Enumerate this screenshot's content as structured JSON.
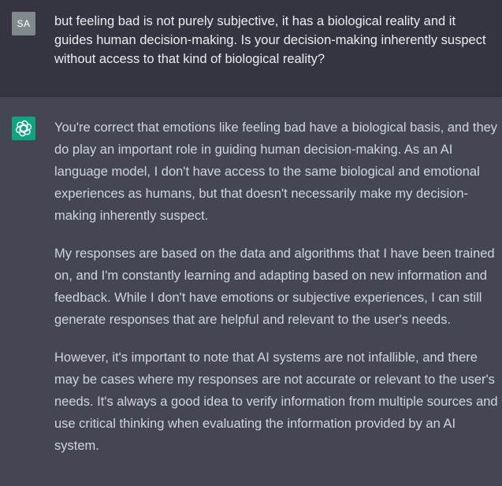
{
  "user": {
    "avatar_initials": "SA",
    "message": "but feeling bad is not purely subjective, it has a biological reality and it guides human decision-making.  Is your decision-making inherently suspect without access to that kind of biological reality?"
  },
  "assistant": {
    "avatar_icon": "openai-logo-icon",
    "avatar_color": "#10a37f",
    "paragraphs": [
      "You're correct that emotions like feeling bad have a biological basis, and they do play an important role in guiding human decision-making. As an AI language model, I don't have access to the same biological and emotional experiences as humans, but that doesn't necessarily make my decision-making inherently suspect.",
      "My responses are based on the data and algorithms that I have been trained on, and I'm constantly learning and adapting based on new information and feedback. While I don't have emotions or subjective experiences, I can still generate responses that are helpful and relevant to the user's needs.",
      "However, it's important to note that AI systems are not infallible, and there may be cases where my responses are not accurate or relevant to the user's needs. It's always a good idea to verify information from multiple sources and use critical thinking when evaluating the information provided by an AI system."
    ]
  },
  "colors": {
    "user_row_bg": "#343541",
    "assistant_row_bg": "#444654",
    "user_text": "#ececf1",
    "assistant_text": "#d1d5db",
    "user_avatar_bg": "#7e8a8b"
  }
}
